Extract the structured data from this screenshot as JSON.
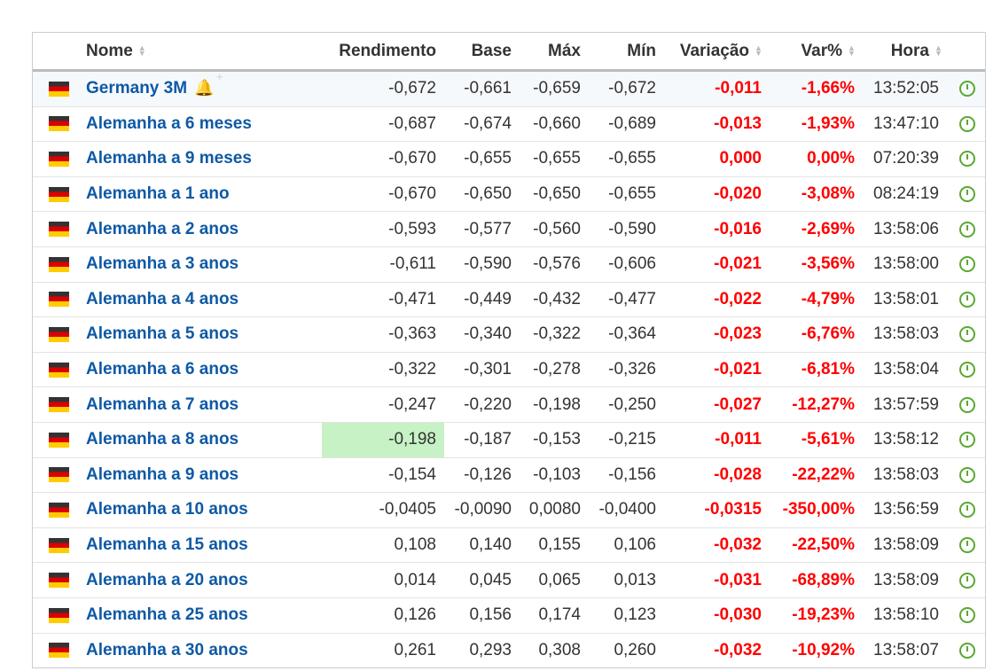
{
  "headers": {
    "name": "Nome",
    "yield": "Rendimento",
    "base": "Base",
    "max": "Máx",
    "min": "Mín",
    "change": "Variação",
    "change_pct": "Var%",
    "time": "Hora"
  },
  "colors": {
    "name": "#0e59a5",
    "negative": "#ff0000",
    "highlight": "#c6f2c6",
    "clock": "#5aa832"
  },
  "rows": [
    {
      "name": "Germany 3M",
      "yield": "-0,672",
      "base": "-0,661",
      "max": "-0,659",
      "min": "-0,672",
      "change": "-0,011",
      "change_pct": "-1,66%",
      "time": "13:52:05"
    },
    {
      "name": "Alemanha a 6 meses",
      "yield": "-0,687",
      "base": "-0,674",
      "max": "-0,660",
      "min": "-0,689",
      "change": "-0,013",
      "change_pct": "-1,93%",
      "time": "13:47:10"
    },
    {
      "name": "Alemanha a 9 meses",
      "yield": "-0,670",
      "base": "-0,655",
      "max": "-0,655",
      "min": "-0,655",
      "change": "0,000",
      "change_pct": "0,00%",
      "time": "07:20:39"
    },
    {
      "name": "Alemanha a 1 ano",
      "yield": "-0,670",
      "base": "-0,650",
      "max": "-0,650",
      "min": "-0,655",
      "change": "-0,020",
      "change_pct": "-3,08%",
      "time": "08:24:19"
    },
    {
      "name": "Alemanha a 2 anos",
      "yield": "-0,593",
      "base": "-0,577",
      "max": "-0,560",
      "min": "-0,590",
      "change": "-0,016",
      "change_pct": "-2,69%",
      "time": "13:58:06"
    },
    {
      "name": "Alemanha a 3 anos",
      "yield": "-0,611",
      "base": "-0,590",
      "max": "-0,576",
      "min": "-0,606",
      "change": "-0,021",
      "change_pct": "-3,56%",
      "time": "13:58:00"
    },
    {
      "name": "Alemanha a 4 anos",
      "yield": "-0,471",
      "base": "-0,449",
      "max": "-0,432",
      "min": "-0,477",
      "change": "-0,022",
      "change_pct": "-4,79%",
      "time": "13:58:01"
    },
    {
      "name": "Alemanha a 5 anos",
      "yield": "-0,363",
      "base": "-0,340",
      "max": "-0,322",
      "min": "-0,364",
      "change": "-0,023",
      "change_pct": "-6,76%",
      "time": "13:58:03"
    },
    {
      "name": "Alemanha a 6 anos",
      "yield": "-0,322",
      "base": "-0,301",
      "max": "-0,278",
      "min": "-0,326",
      "change": "-0,021",
      "change_pct": "-6,81%",
      "time": "13:58:04"
    },
    {
      "name": "Alemanha a 7 anos",
      "yield": "-0,247",
      "base": "-0,220",
      "max": "-0,198",
      "min": "-0,250",
      "change": "-0,027",
      "change_pct": "-12,27%",
      "time": "13:57:59"
    },
    {
      "name": "Alemanha a 8 anos",
      "yield": "-0,198",
      "base": "-0,187",
      "max": "-0,153",
      "min": "-0,215",
      "change": "-0,011",
      "change_pct": "-5,61%",
      "time": "13:58:12",
      "highlight": true
    },
    {
      "name": "Alemanha a 9 anos",
      "yield": "-0,154",
      "base": "-0,126",
      "max": "-0,103",
      "min": "-0,156",
      "change": "-0,028",
      "change_pct": "-22,22%",
      "time": "13:58:03"
    },
    {
      "name": "Alemanha a 10 anos",
      "yield": "-0,0405",
      "base": "-0,0090",
      "max": "0,0080",
      "min": "-0,0400",
      "change": "-0,0315",
      "change_pct": "-350,00%",
      "time": "13:56:59"
    },
    {
      "name": "Alemanha a 15 anos",
      "yield": "0,108",
      "base": "0,140",
      "max": "0,155",
      "min": "0,106",
      "change": "-0,032",
      "change_pct": "-22,50%",
      "time": "13:58:09"
    },
    {
      "name": "Alemanha a 20 anos",
      "yield": "0,014",
      "base": "0,045",
      "max": "0,065",
      "min": "0,013",
      "change": "-0,031",
      "change_pct": "-68,89%",
      "time": "13:58:09"
    },
    {
      "name": "Alemanha a 25 anos",
      "yield": "0,126",
      "base": "0,156",
      "max": "0,174",
      "min": "0,123",
      "change": "-0,030",
      "change_pct": "-19,23%",
      "time": "13:58:10"
    },
    {
      "name": "Alemanha a 30 anos",
      "yield": "0,261",
      "base": "0,293",
      "max": "0,308",
      "min": "0,260",
      "change": "-0,032",
      "change_pct": "-10,92%",
      "time": "13:58:07"
    }
  ]
}
